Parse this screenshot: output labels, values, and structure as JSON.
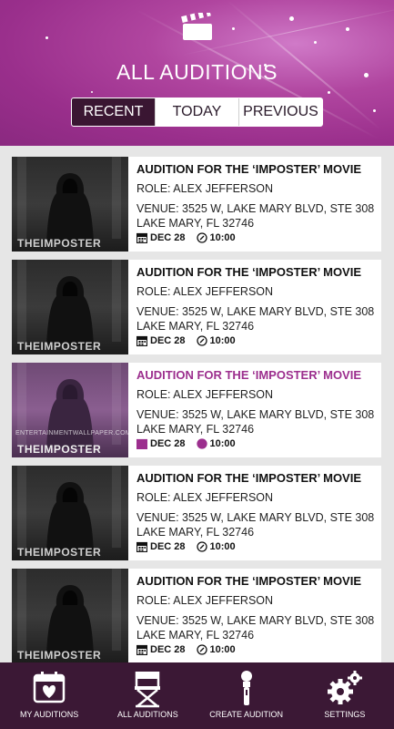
{
  "header": {
    "title": "ALL AUDITIONS",
    "tabs": [
      {
        "label": "RECENT",
        "active": true
      },
      {
        "label": "TODAY",
        "active": false
      },
      {
        "label": "PREVIOUS",
        "active": false
      }
    ]
  },
  "auditions": [
    {
      "title": "AUDITION FOR THE ‘IMPOSTER’ MOVIE",
      "role": "ROLE: ALEX JEFFERSON",
      "venue_line1": "VENUE: 3525 W, LAKE MARY BLVD, STE 308",
      "venue_line2": "LAKE MARY, FL 32746",
      "date": "DEC 28",
      "time": "10:00",
      "thumb_brand": "THEIMPOSTER",
      "highlighted": false
    },
    {
      "title": "AUDITION FOR THE ‘IMPOSTER’ MOVIE",
      "role": "ROLE: ALEX JEFFERSON",
      "venue_line1": "VENUE: 3525 W, LAKE MARY BLVD, STE 308",
      "venue_line2": "LAKE MARY, FL 32746",
      "date": "DEC 28",
      "time": "10:00",
      "thumb_brand": "THEIMPOSTER",
      "highlighted": false
    },
    {
      "title": "AUDITION FOR THE ‘IMPOSTER’ MOVIE",
      "role": "ROLE: ALEX JEFFERSON",
      "venue_line1": "VENUE: 3525 W, LAKE MARY BLVD, STE 308",
      "venue_line2": "LAKE MARY, FL 32746",
      "date": "DEC 28",
      "time": "10:00",
      "thumb_brand": "THEIMPOSTER",
      "thumb_watermark": "ENTERTAINMENTWALLPAPER.COM",
      "highlighted": true
    },
    {
      "title": "AUDITION FOR THE ‘IMPOSTER’ MOVIE",
      "role": "ROLE: ALEX JEFFERSON",
      "venue_line1": "VENUE: 3525 W, LAKE MARY BLVD, STE 308",
      "venue_line2": "LAKE MARY, FL 32746",
      "date": "DEC 28",
      "time": "10:00",
      "thumb_brand": "THEIMPOSTER",
      "highlighted": false
    },
    {
      "title": "AUDITION FOR THE ‘IMPOSTER’ MOVIE",
      "role": "ROLE: ALEX JEFFERSON",
      "venue_line1": "VENUE: 3525 W, LAKE MARY BLVD, STE 308",
      "venue_line2": "LAKE MARY, FL 32746",
      "date": "DEC 28",
      "time": "10:00",
      "thumb_brand": "THEIMPOSTER",
      "highlighted": false
    }
  ],
  "nav": [
    {
      "label": "MY AUDITIONS",
      "icon": "calendar-heart-icon"
    },
    {
      "label": "ALL AUDITIONS",
      "icon": "director-chair-icon"
    },
    {
      "label": "CREATE AUDITION",
      "icon": "microphone-icon"
    },
    {
      "label": "SETTINGS",
      "icon": "gears-icon"
    }
  ],
  "colors": {
    "accent": "#9c2f8e",
    "nav_bg": "#3b1835",
    "header_bg": "#b0459f",
    "tab_active_bg": "#3a1632"
  }
}
